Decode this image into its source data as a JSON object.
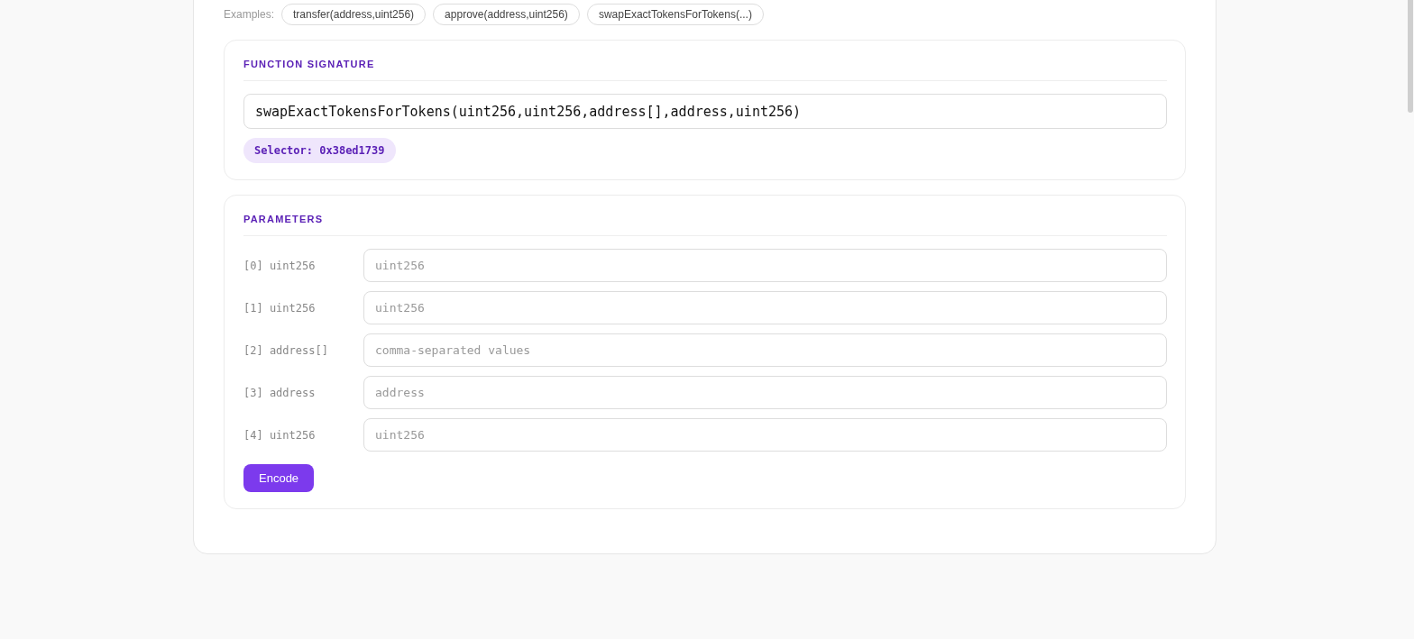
{
  "examples": {
    "label": "Examples:",
    "items": [
      "transfer(address,uint256)",
      "approve(address,uint256)",
      "swapExactTokensForTokens(...)"
    ]
  },
  "signature_card": {
    "title": "FUNCTION SIGNATURE",
    "value": "swapExactTokensForTokens(uint256,uint256,address[],address,uint256)",
    "selector": "Selector: 0x38ed1739"
  },
  "parameters_card": {
    "title": "PARAMETERS",
    "params": [
      {
        "label": "[0] uint256",
        "placeholder": "uint256"
      },
      {
        "label": "[1] uint256",
        "placeholder": "uint256"
      },
      {
        "label": "[2] address[]",
        "placeholder": "comma-separated values"
      },
      {
        "label": "[3] address",
        "placeholder": "address"
      },
      {
        "label": "[4] uint256",
        "placeholder": "uint256"
      }
    ],
    "button": "Encode"
  }
}
